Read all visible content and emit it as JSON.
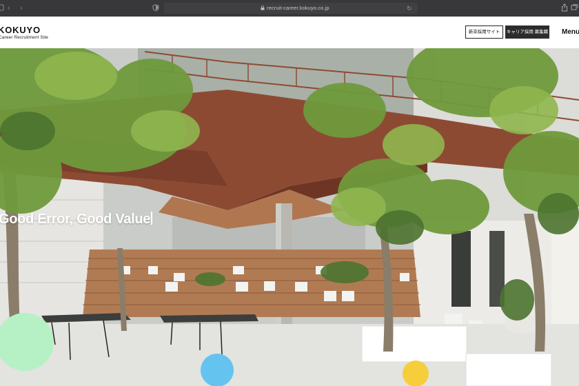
{
  "browser": {
    "url": "recruit-career.kokuyo.co.jp",
    "back_glyph": "‹",
    "forward_glyph": "›",
    "reload_glyph": "↻",
    "icons": [
      "sidebar-icon",
      "back-icon",
      "forward-icon",
      "shield-icon",
      "lock-icon",
      "reload-icon",
      "share-icon",
      "tabs-icon"
    ]
  },
  "header": {
    "logo": "KOKUYO",
    "subtitle": "Career Recruitment Site",
    "new_grad_button": "新卒採用サイト",
    "career_button": "キャリア採用 募集職種",
    "menu_label": "Menu"
  },
  "hero": {
    "title": "Good Error, Good Value"
  },
  "colors": {
    "chrome_bg": "#38383a",
    "header_bg": "#ffffff",
    "dark_button": "#2c2c2c",
    "bubble_green": "#b5f1c4",
    "bubble_blue": "#64c4ef",
    "bubble_yellow": "#f6ce3c",
    "walkway_rust": "#8d4a33"
  }
}
